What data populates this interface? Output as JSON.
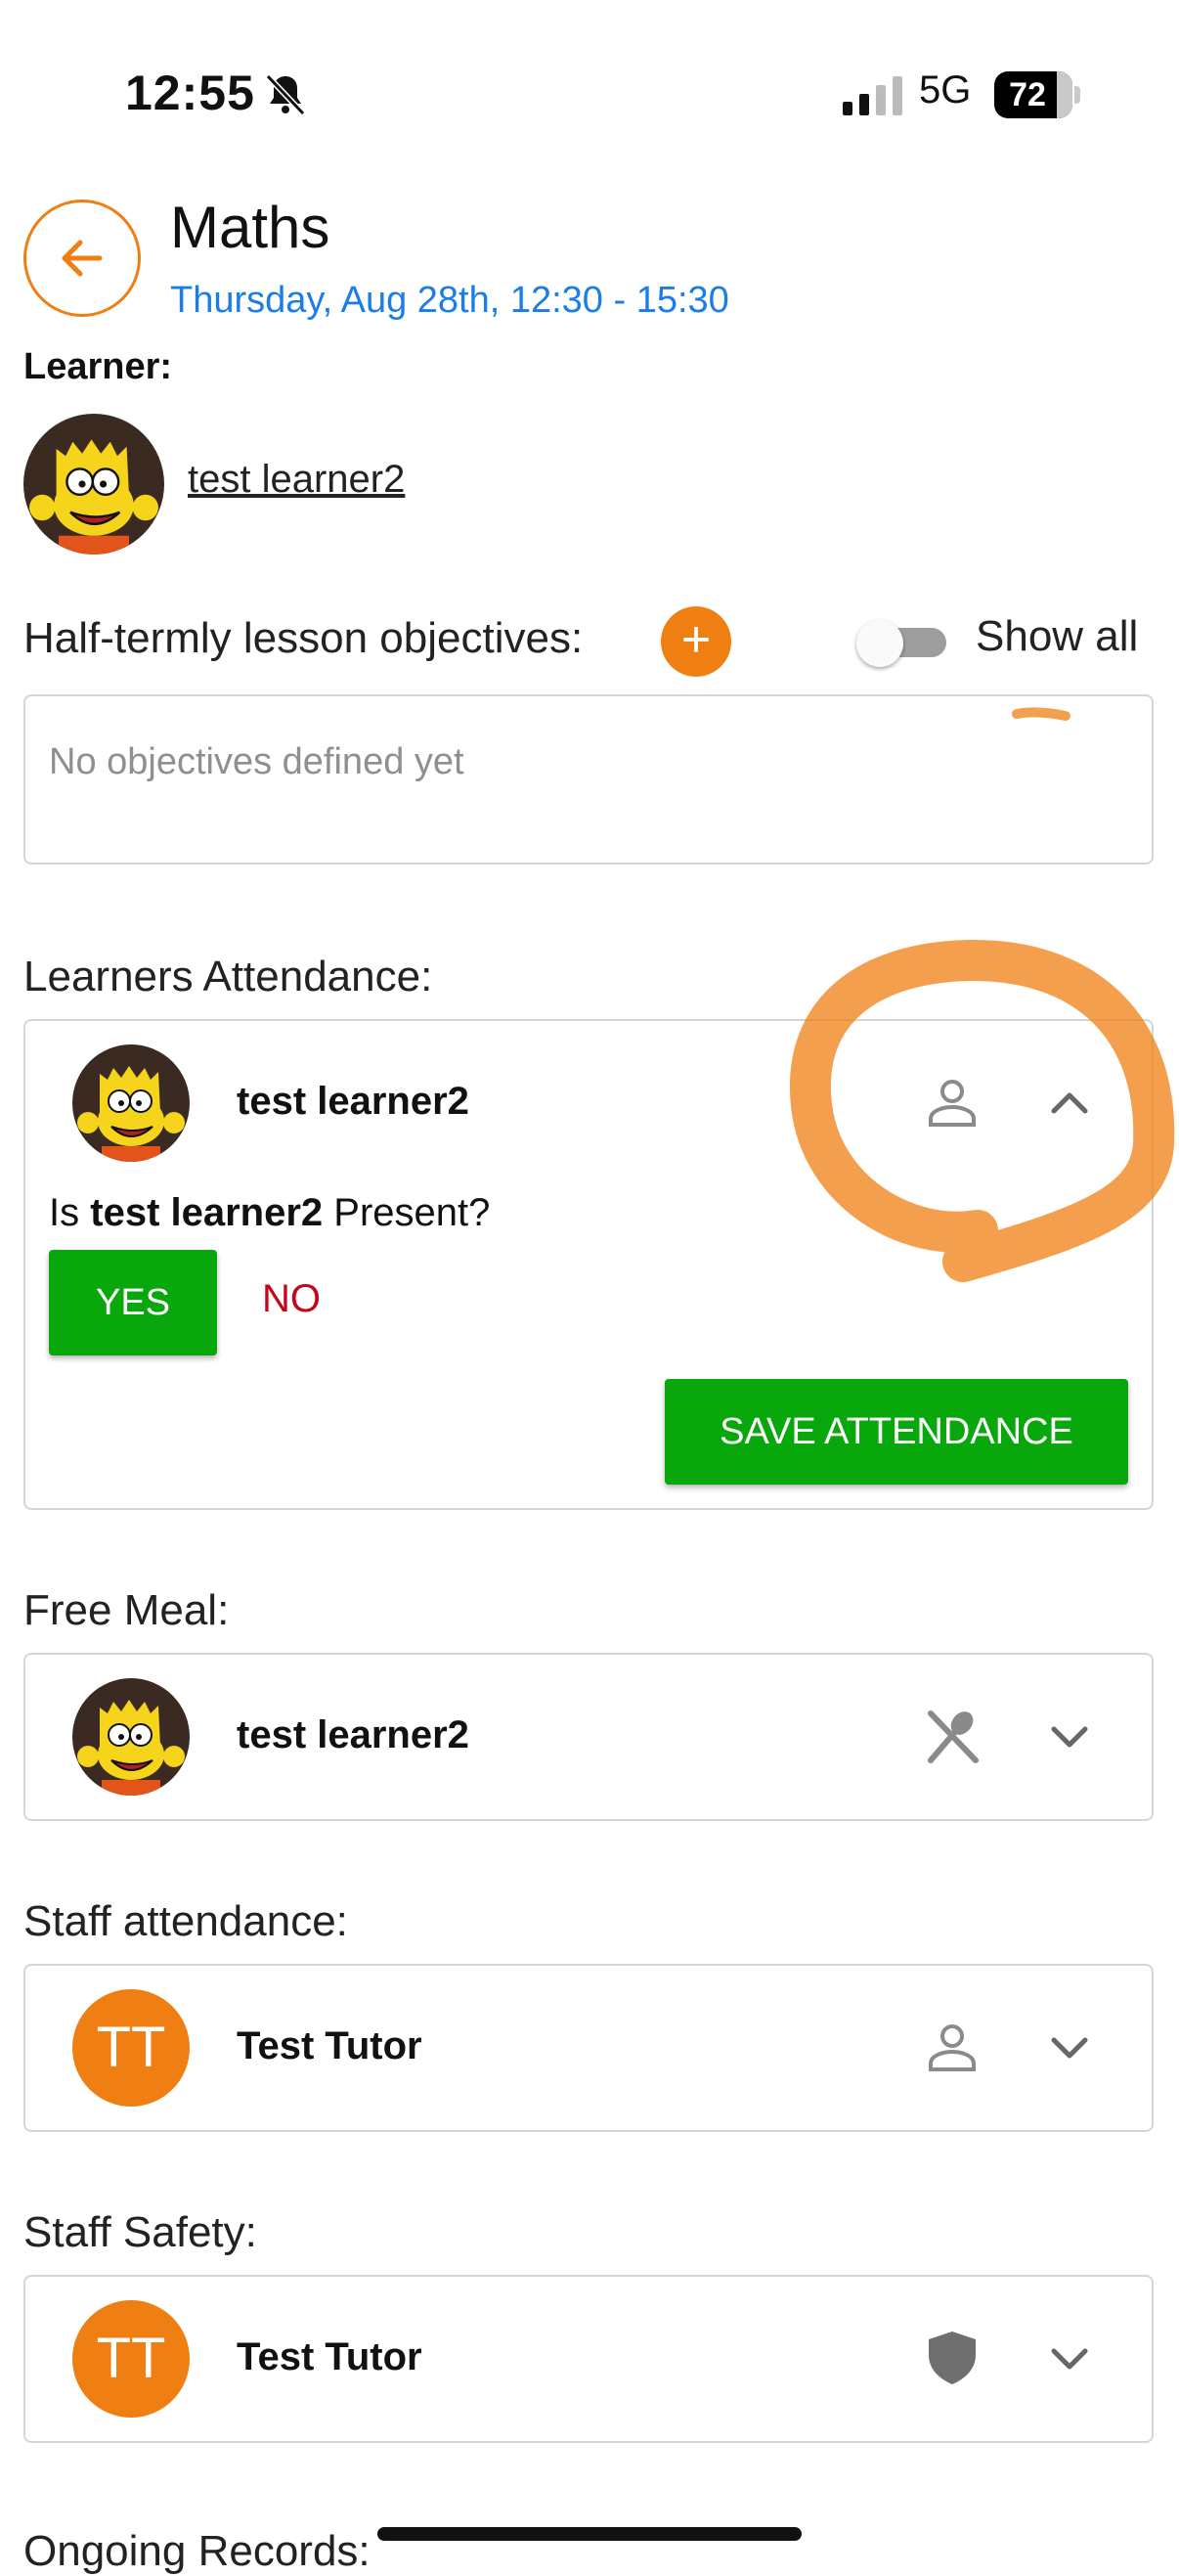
{
  "status_bar": {
    "time": "12:55",
    "network": "5G",
    "battery": "72"
  },
  "header": {
    "title": "Maths",
    "subtitle": "Thursday, Aug 28th, 12:30 - 15:30"
  },
  "learner": {
    "label": "Learner:",
    "name": "test learner2"
  },
  "objectives": {
    "label": "Half-termly lesson objectives:",
    "add_symbol": "+",
    "show_all_label": "Show all",
    "show_all_enabled": false,
    "placeholder": "No objectives defined yet"
  },
  "attendance": {
    "label": "Learners Attendance:",
    "name": "test learner2",
    "question_prefix": "Is",
    "question_name": "test learner2",
    "question_suffix": "Present?",
    "yes_label": "YES",
    "no_label": "NO",
    "save_label": "SAVE ATTENDANCE"
  },
  "free_meal": {
    "label": "Free Meal:",
    "name": "test learner2"
  },
  "staff_attendance": {
    "label": "Staff attendance:",
    "initials": "TT",
    "name": "Test Tutor"
  },
  "staff_safety": {
    "label": "Staff Safety:",
    "initials": "TT",
    "name": "Test Tutor"
  },
  "next_section": {
    "label": "Ongoing Records:"
  },
  "colors": {
    "accent": "#f07f13",
    "link_blue": "#1a7ee6",
    "success_green": "#08a80c",
    "danger_red": "#c4061d"
  }
}
